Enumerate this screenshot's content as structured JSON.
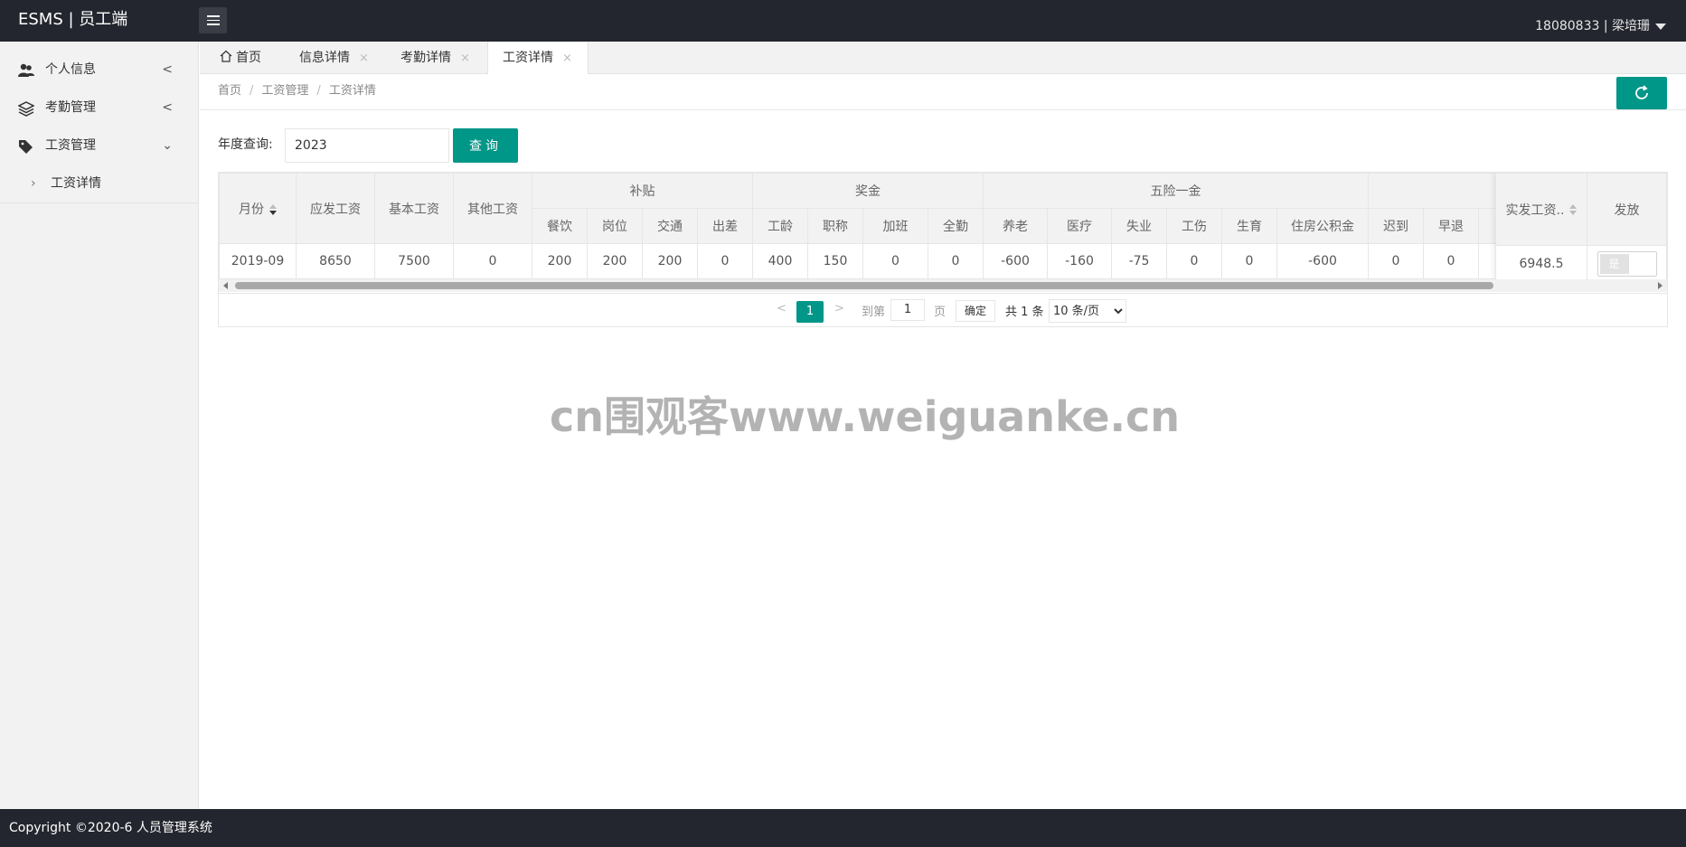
{
  "app": {
    "title": "ESMS | 员工端",
    "user": "18080833 | 梁培珊"
  },
  "sidebar": {
    "items": [
      {
        "label": "个人信息"
      },
      {
        "label": "考勤管理"
      },
      {
        "label": "工资管理"
      }
    ],
    "sub_items": [
      {
        "label": "工资详情"
      }
    ]
  },
  "tabs": [
    {
      "label": "首页",
      "closable": false
    },
    {
      "label": "信息详情",
      "closable": true
    },
    {
      "label": "考勤详情",
      "closable": true
    },
    {
      "label": "工资详情",
      "closable": true,
      "active": true
    }
  ],
  "tab_close_glyph": "×",
  "breadcrumb": [
    "首页",
    "工资管理",
    "工资详情"
  ],
  "breadcrumb_sep": "/",
  "query": {
    "label": "年度查询:",
    "value": "2023",
    "button": "查询"
  },
  "table": {
    "groups": {
      "subsidy": "补贴",
      "bonus": "奖金",
      "insurance": "五险一金"
    },
    "headers": {
      "month": "月份",
      "gross": "应发工资",
      "base": "基本工资",
      "other": "其他工资",
      "meal": "餐饮",
      "post": "岗位",
      "traffic": "交通",
      "travel": "出差",
      "seniority": "工龄",
      "title": "职称",
      "overtime": "加班",
      "attendance": "全勤",
      "pension": "养老",
      "medical": "医疗",
      "unemployment": "失业",
      "injury": "工伤",
      "maternity": "生育",
      "housing": "住房公积金",
      "late": "迟到",
      "early": "早退",
      "net": "实发工资..",
      "paid": "发放"
    },
    "rows": [
      {
        "month": "2019-09",
        "gross": "8650",
        "base": "7500",
        "other": "0",
        "meal": "200",
        "post": "200",
        "traffic": "200",
        "travel": "0",
        "seniority": "400",
        "title": "150",
        "overtime": "0",
        "attendance": "0",
        "pension": "-600",
        "medical": "-160",
        "unemployment": "-75",
        "injury": "0",
        "maternity": "0",
        "housing": "-600",
        "late": "0",
        "early": "0",
        "net": "6948.5",
        "paid_switch": "是"
      }
    ]
  },
  "pager": {
    "current": "1",
    "goto_label": "到第",
    "goto_value": "1",
    "page_unit": "页",
    "confirm": "确定",
    "total": "共 1 条",
    "page_size": "10 条/页",
    "page_size_options": [
      "10 条/页"
    ]
  },
  "watermark": "cn围观客www.weiguanke.cn",
  "footer": {
    "copyright": "Copyright ©2020-6 人员管理系统"
  },
  "colors": {
    "accent": "#009688",
    "topbar": "#23262e",
    "sidebar": "#f2f2f2"
  }
}
